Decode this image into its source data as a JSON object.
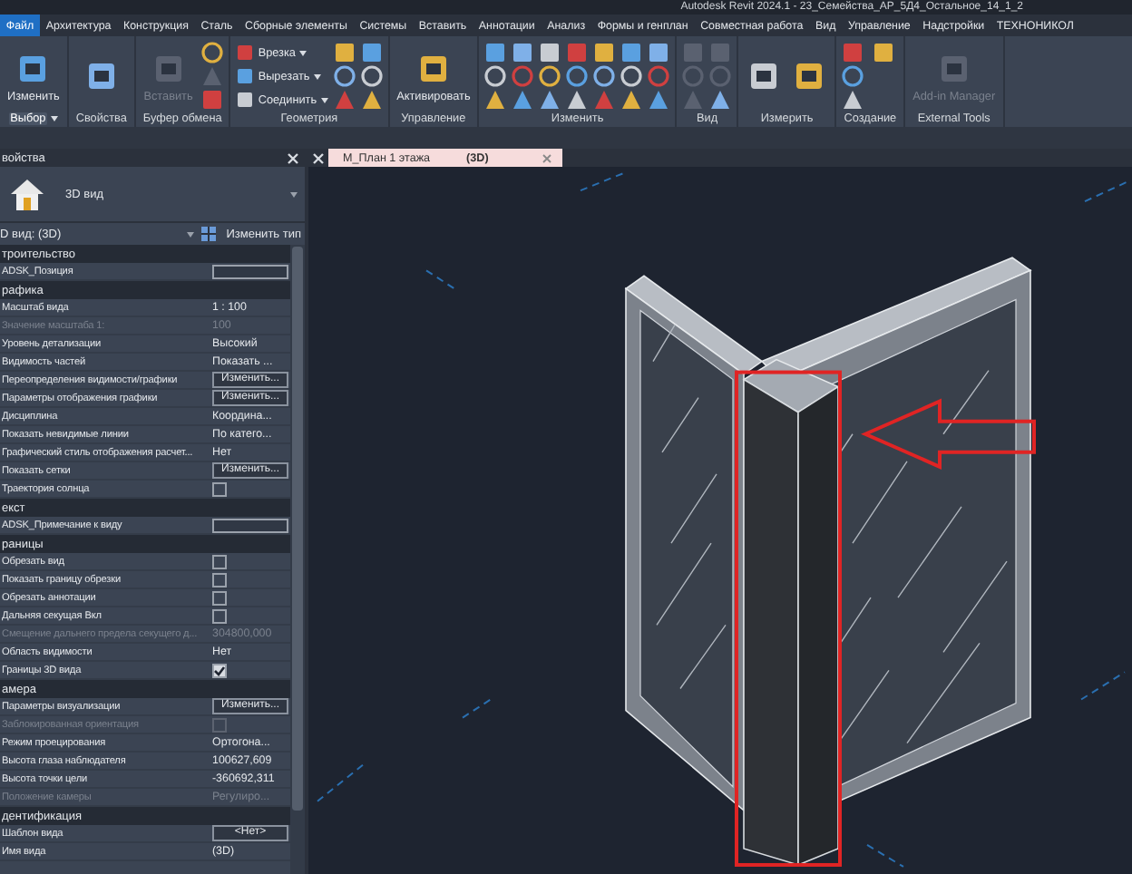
{
  "title_bar": {
    "title": "Autodesk Revit 2024.1 - 23_Семейства_АР_5Д4_Остальное_14_1_2"
  },
  "ribbon_tabs": [
    {
      "label": "Файл",
      "selected": true
    },
    {
      "label": "Архитектура",
      "selected": false
    },
    {
      "label": "Конструкция",
      "selected": false
    },
    {
      "label": "Сталь",
      "selected": false
    },
    {
      "label": "Сборные элементы",
      "selected": false
    },
    {
      "label": "Системы",
      "selected": false
    },
    {
      "label": "Вставить",
      "selected": false
    },
    {
      "label": "Аннотации",
      "selected": false
    },
    {
      "label": "Анализ",
      "selected": false
    },
    {
      "label": "Формы и генплан",
      "selected": false
    },
    {
      "label": "Совместная работа",
      "selected": false
    },
    {
      "label": "Вид",
      "selected": false
    },
    {
      "label": "Управление",
      "selected": false
    },
    {
      "label": "Надстройки",
      "selected": false
    },
    {
      "label": "ТЕХНОНИКОЛ",
      "selected": false
    }
  ],
  "ribbon_panels": [
    {
      "label": "Выбор",
      "menu": true,
      "buttons": [
        {
          "kind": "large",
          "label": "Изменить",
          "disabled": false
        }
      ]
    },
    {
      "label": "Свойства",
      "menu": false,
      "buttons": [
        {
          "kind": "large",
          "disabled": false
        }
      ]
    },
    {
      "label": "Буфер обмена",
      "menu": false,
      "buttons": [
        {
          "kind": "large",
          "label": "Вставить",
          "disabled": true
        },
        {
          "kind": "icon",
          "disabled": false
        },
        {
          "kind": "icon",
          "disabled": true
        },
        {
          "kind": "icon",
          "disabled": false
        }
      ]
    },
    {
      "label": "Геометрия",
      "menu": false,
      "buttons": [
        {
          "kind": "small",
          "label": "Врезка",
          "disabled": false
        },
        {
          "kind": "small",
          "label": "Вырезать",
          "disabled": false
        },
        {
          "kind": "small",
          "label": "Соединить",
          "disabled": false
        },
        {
          "kind": "icon",
          "disabled": false
        },
        {
          "kind": "icon",
          "disabled": false
        },
        {
          "kind": "icon",
          "disabled": false
        },
        {
          "kind": "icon",
          "disabled": false
        },
        {
          "kind": "icon",
          "disabled": false
        },
        {
          "kind": "icon",
          "disabled": false
        }
      ]
    },
    {
      "label": "Управление",
      "menu": false,
      "buttons": [
        {
          "kind": "large",
          "label": "Активировать",
          "disabled": false
        }
      ]
    },
    {
      "label": "Изменить",
      "menu": false,
      "buttons": [
        {
          "kind": "icon",
          "disabled": false
        },
        {
          "kind": "icon",
          "disabled": false
        },
        {
          "kind": "icon",
          "disabled": false
        },
        {
          "kind": "icon",
          "disabled": false
        },
        {
          "kind": "icon",
          "disabled": false
        },
        {
          "kind": "icon",
          "disabled": false
        },
        {
          "kind": "icon",
          "disabled": false
        },
        {
          "kind": "icon",
          "disabled": false
        },
        {
          "kind": "icon",
          "disabled": false
        },
        {
          "kind": "icon",
          "disabled": false
        },
        {
          "kind": "icon",
          "disabled": false
        },
        {
          "kind": "icon",
          "disabled": false
        },
        {
          "kind": "icon",
          "disabled": false
        },
        {
          "kind": "icon",
          "disabled": false
        },
        {
          "kind": "icon",
          "disabled": false
        },
        {
          "kind": "icon",
          "disabled": false
        },
        {
          "kind": "icon",
          "disabled": false
        },
        {
          "kind": "icon",
          "disabled": false
        },
        {
          "kind": "icon",
          "disabled": false
        },
        {
          "kind": "icon",
          "disabled": false
        },
        {
          "kind": "icon",
          "disabled": false
        }
      ]
    },
    {
      "label": "Вид",
      "menu": false,
      "buttons": [
        {
          "kind": "icon",
          "disabled": true
        },
        {
          "kind": "icon",
          "disabled": true
        },
        {
          "kind": "icon",
          "disabled": true
        },
        {
          "kind": "icon",
          "disabled": true
        },
        {
          "kind": "icon",
          "disabled": true
        },
        {
          "kind": "icon",
          "disabled": false
        }
      ]
    },
    {
      "label": "Измерить",
      "menu": false,
      "buttons": [
        {
          "kind": "large",
          "disabled": false
        },
        {
          "kind": "large",
          "disabled": false
        }
      ]
    },
    {
      "label": "Создание",
      "menu": false,
      "buttons": [
        {
          "kind": "icon",
          "disabled": false
        },
        {
          "kind": "icon",
          "disabled": false
        },
        {
          "kind": "icon",
          "disabled": false
        },
        {
          "kind": "icon",
          "disabled": false
        }
      ]
    },
    {
      "label": "External Tools",
      "menu": false,
      "buttons": [
        {
          "kind": "large",
          "label": "Add-in Manager",
          "disabled": true
        }
      ]
    }
  ],
  "properties": {
    "title": "войства",
    "type_name": "3D вид",
    "instance": "D вид: (3D)",
    "edit_type": "Изменить тип",
    "groups": [
      {
        "name": "троительство",
        "rows": [
          {
            "label": "ADSK_Позиция",
            "kind": "field",
            "disabled": false
          }
        ]
      },
      {
        "name": "рафика",
        "rows": [
          {
            "label": "Масштаб вида",
            "kind": "text",
            "value": "1 : 100",
            "disabled": false
          },
          {
            "label": "Значение масштаба    1:",
            "kind": "text",
            "value": "100",
            "disabled": true
          },
          {
            "label": "Уровень детализации",
            "kind": "text",
            "value": "Высокий",
            "disabled": false
          },
          {
            "label": "Видимость частей",
            "kind": "text",
            "value": "Показать ...",
            "disabled": false
          },
          {
            "label": "Переопределения видимости/графики",
            "kind": "button",
            "value": "Изменить...",
            "disabled": false
          },
          {
            "label": "Параметры отображения графики",
            "kind": "button",
            "value": "Изменить...",
            "disabled": false
          },
          {
            "label": "Дисциплина",
            "kind": "text",
            "value": "Координа...",
            "disabled": false
          },
          {
            "label": "Показать невидимые линии",
            "kind": "text",
            "value": "По катего...",
            "disabled": false
          },
          {
            "label": "Графический стиль отображения расчет...",
            "kind": "text",
            "value": "Нет",
            "disabled": false
          },
          {
            "label": "Показать сетки",
            "kind": "button",
            "value": "Изменить...",
            "disabled": false
          },
          {
            "label": "Траектория солнца",
            "kind": "checkbox",
            "checked": false,
            "disabled": false
          }
        ]
      },
      {
        "name": "екст",
        "rows": [
          {
            "label": "ADSK_Примечание к виду",
            "kind": "field",
            "disabled": false
          }
        ]
      },
      {
        "name": "раницы",
        "rows": [
          {
            "label": "Обрезать вид",
            "kind": "checkbox",
            "checked": false,
            "disabled": false
          },
          {
            "label": "Показать границу обрезки",
            "kind": "checkbox",
            "checked": false,
            "disabled": false
          },
          {
            "label": "Обрезать аннотации",
            "kind": "checkbox",
            "checked": false,
            "disabled": false
          },
          {
            "label": "Дальняя секущая Вкл",
            "kind": "checkbox",
            "checked": false,
            "disabled": false
          },
          {
            "label": "Смещение дальнего предела секущего д...",
            "kind": "text",
            "value": "304800,000",
            "disabled": true
          },
          {
            "label": "Область видимости",
            "kind": "text",
            "value": "Нет",
            "disabled": false
          },
          {
            "label": "Границы 3D вида",
            "kind": "checkbox",
            "checked": true,
            "disabled": false
          }
        ]
      },
      {
        "name": "амера",
        "rows": [
          {
            "label": "Параметры визуализации",
            "kind": "button",
            "value": "Изменить...",
            "disabled": false
          },
          {
            "label": "Заблокированная ориентация",
            "kind": "checkbox",
            "checked": false,
            "disabled": true
          },
          {
            "label": "Режим проецирования",
            "kind": "text",
            "value": "Ортогона...",
            "disabled": false
          },
          {
            "label": "Высота глаза наблюдателя",
            "kind": "text",
            "value": "100627,609",
            "disabled": false
          },
          {
            "label": "Высота точки цели",
            "kind": "text",
            "value": "-360692,311",
            "disabled": false
          },
          {
            "label": "Положение камеры",
            "kind": "text",
            "value": "Регулиро...",
            "disabled": true
          }
        ]
      },
      {
        "name": "дентификация",
        "rows": [
          {
            "label": "Шаблон вида",
            "kind": "button",
            "value": "<Нет>",
            "disabled": false
          },
          {
            "label": "Имя вида",
            "kind": "text",
            "value": "(3D)",
            "disabled": false
          }
        ]
      }
    ]
  },
  "view_tabs": [
    {
      "label": "М_План 1 этажа",
      "selected": false
    },
    {
      "label": "(3D)",
      "selected": true
    }
  ]
}
